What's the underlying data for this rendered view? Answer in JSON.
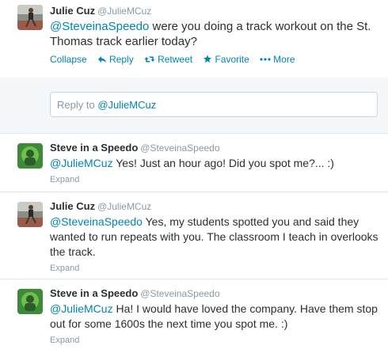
{
  "tweets": [
    {
      "fullname": "Julie Cuz",
      "username": "@JulieMCuz",
      "mention": "@SteveinaSpeedo",
      "text": " were you doing a track workout on the St. Thomas track earlier today?",
      "avatar": "runner-avatar"
    },
    {
      "fullname": "Steve in a Speedo",
      "username": "@SteveinaSpeedo",
      "mention": "@JulieMCuz",
      "text": " Yes!  Just an hour ago!  Did you spot me?...  :)",
      "expand": "Expand",
      "avatar": "swimmer-avatar"
    },
    {
      "fullname": "Julie Cuz",
      "username": "@JulieMCuz",
      "mention": "@SteveinaSpeedo",
      "text": " Yes, my students spotted you and said they wanted to run repeats with you. The classroom I teach in overlooks the track.",
      "expand": "Expand",
      "avatar": "runner-avatar"
    },
    {
      "fullname": "Steve in a Speedo",
      "username": "@SteveinaSpeedo",
      "mention": "@JulieMCuz",
      "text": " Ha! I would have loved the company.  Have them stop out for some 1600s the next time you spot me.  :)",
      "expand": "Expand",
      "avatar": "swimmer-avatar"
    }
  ],
  "actions": {
    "collapse": "Collapse",
    "reply": "Reply",
    "retweet": "Retweet",
    "favorite": "Favorite",
    "more": "More"
  },
  "reply_box": {
    "prefix": "Reply to ",
    "mention": "@JulieMCuz"
  },
  "colors": {
    "link": "#0084b4",
    "muted": "#8899a6",
    "text": "#292f33",
    "divider": "#e1e8ed",
    "reply_bg": "#f5f8fa"
  }
}
